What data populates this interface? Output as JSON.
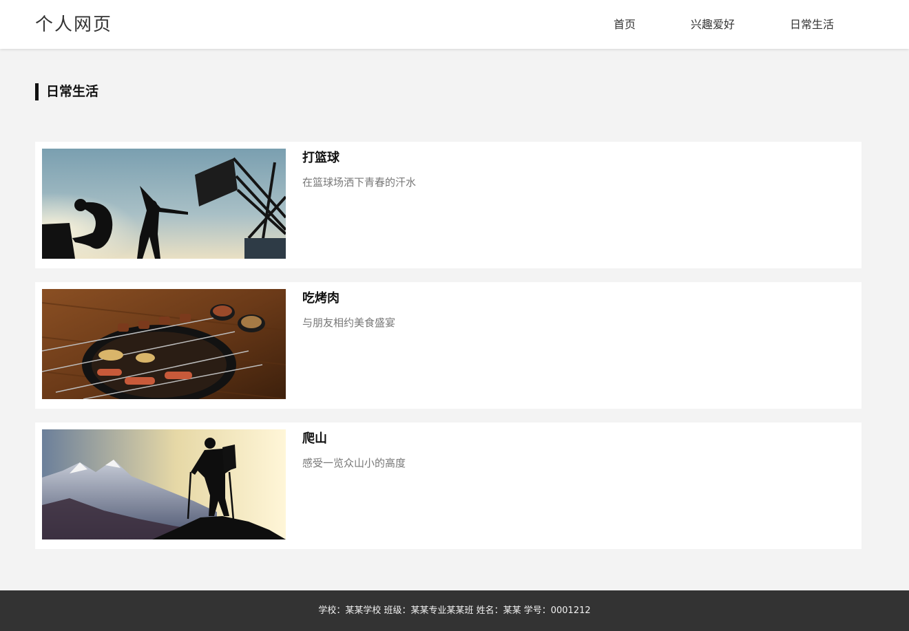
{
  "header": {
    "logo": "个人网页",
    "nav": [
      "首页",
      "兴趣爱好",
      "日常生活"
    ]
  },
  "section": {
    "title": "日常生活"
  },
  "cards": [
    {
      "title": "打篮球",
      "desc": "在篮球场洒下青春的汗水"
    },
    {
      "title": "吃烤肉",
      "desc": "与朋友相约美食盛宴"
    },
    {
      "title": "爬山",
      "desc": "感受一览众山小的高度"
    }
  ],
  "footer": {
    "text": "学校：某某学校 班级：某某专业某某班 姓名：某某 学号：0001212"
  }
}
